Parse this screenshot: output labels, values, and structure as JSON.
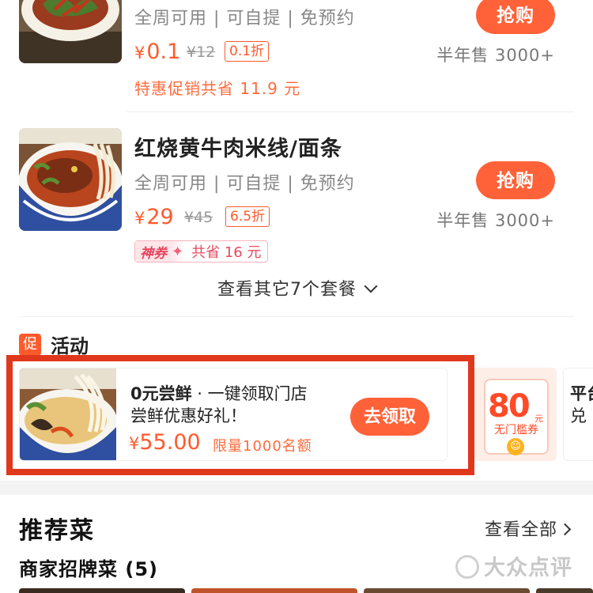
{
  "deals": [
    {
      "title": "",
      "availability": "全周可用 | 可自提 | 免预约",
      "price_symbol": "¥",
      "price": "0.1",
      "original_price": "¥12",
      "discount": "0.1折",
      "sold": "半年售 3000+",
      "buy_label": "抢购",
      "promo": "特惠促销共省 11.9 元"
    },
    {
      "title": "红烧黄牛肉米线/面条",
      "availability": "全周可用 | 可自提 | 免预约",
      "price_symbol": "¥",
      "price": "29",
      "original_price": "¥45",
      "discount": "6.5折",
      "sold": "半年售 3000+",
      "buy_label": "抢购",
      "coupon_tag": "神券",
      "coupon_save": "共省 16 元"
    }
  ],
  "more_packages": "查看其它7个套餐",
  "activity": {
    "badge": "促",
    "title": "活动",
    "card": {
      "headline_bold": "0元尝鲜",
      "headline_rest": " · 一键领取门店",
      "line2": "尝鲜优惠好礼！",
      "price_symbol": "¥",
      "price": "55.00",
      "limit": "限量1000名额",
      "button": "去领取"
    },
    "coupon_card": {
      "amount": "80",
      "unit": "元",
      "label": "无门槛券"
    },
    "third_card": {
      "line1": "平台",
      "line2": "兑"
    }
  },
  "recommended": {
    "title": "推荐菜",
    "see_all": "查看全部",
    "signature": "商家招牌菜 (5)"
  },
  "watermark": "大众点评",
  "colors": {
    "accent": "#ff6238",
    "price": "#ff5a2b",
    "highlight": "#e0381c"
  }
}
